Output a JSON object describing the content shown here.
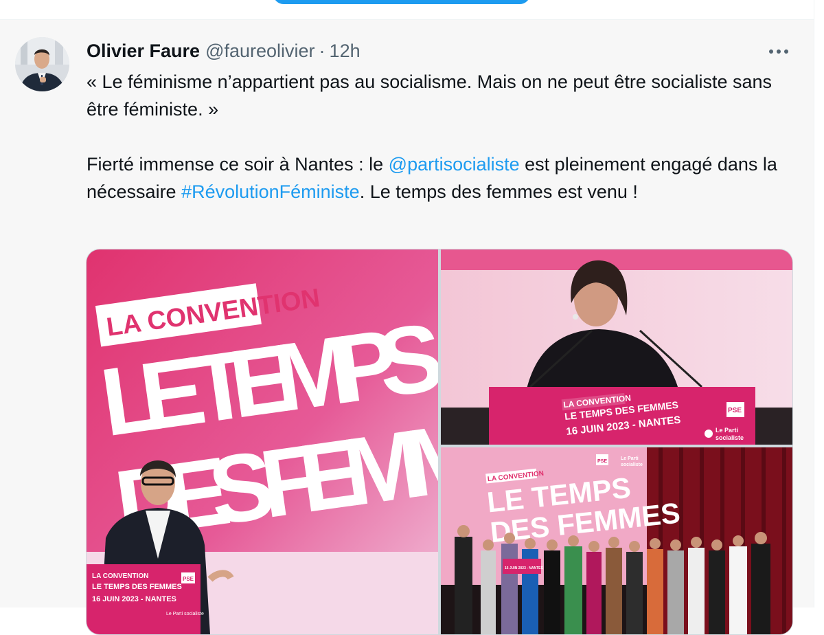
{
  "tweet": {
    "author_name": "Olivier Faure",
    "handle": "@faureolivier",
    "separator": "·",
    "time": "12h",
    "more_icon": "more-horizontal-icon",
    "body": {
      "line1": "« Le féminisme n’appartient pas au socialisme. Mais on ne peut être socialiste sans être féministe. »",
      "p2_before_mention": "Fierté immense ce soir à Nantes : le ",
      "mention": "@partisocialiste",
      "p2_after_mention": " est pleinement engagé dans la nécessaire ",
      "hashtag": "#RévolutionFéministe",
      "p2_end": ". Le temps des femmes est venu !"
    }
  },
  "media": {
    "photo1": {
      "banner_line1": "LA CONVENTION",
      "banner_line2": "LE TEMPS",
      "banner_line3": "DES FEMM",
      "podium_line1": "LA CONVENTION",
      "podium_line2": "LE TEMPS DES FEMMES",
      "podium_line3": "16 JUIN 2023 - NANTES",
      "logo_pse": "PSE",
      "logo_ps": "Le Parti socialiste"
    },
    "photo2": {
      "podium_line1": "LA CONVENTION",
      "podium_line2": "LE TEMPS DES FEMMES",
      "podium_line3": "16 JUIN 2023 - NANTES",
      "logo_pse": "PSE",
      "logo_ps1": "Le Parti",
      "logo_ps2": "socialiste"
    },
    "photo3": {
      "screen_line1": "LA CONVENTION",
      "screen_line2": "LE TEMPS",
      "screen_line3": "DES FEMMES",
      "logo_pse": "PSE",
      "logo_ps1": "Le Parti",
      "logo_ps2": "socialiste",
      "podium_line": "16 JUIN 2023 - NANTES"
    }
  },
  "colors": {
    "link": "#1d9bf0",
    "text": "#0f1419",
    "secondary": "#536471",
    "brand_pink": "#e8317a"
  }
}
